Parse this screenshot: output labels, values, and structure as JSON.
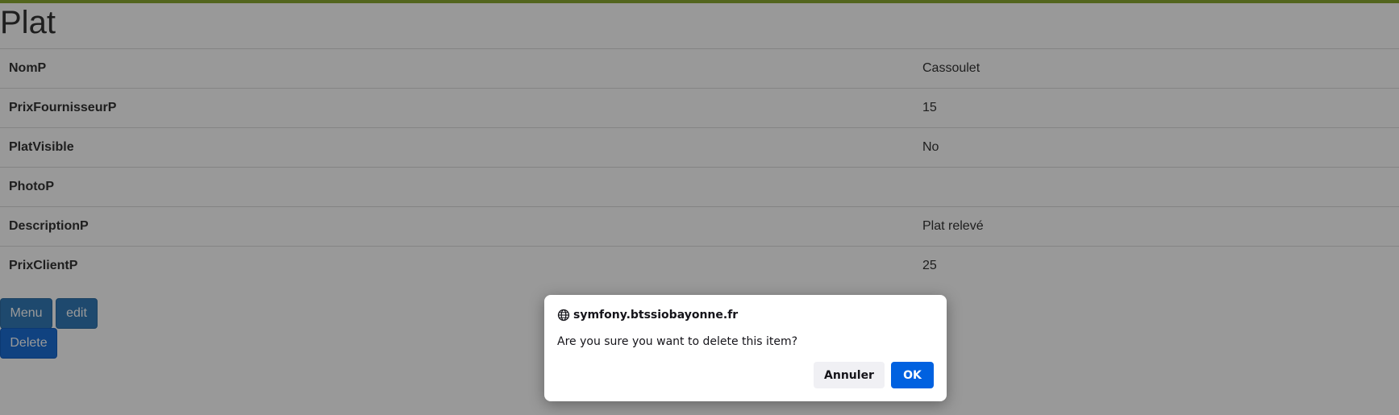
{
  "page": {
    "title": "Plat",
    "rows": [
      {
        "label": "NomP",
        "value": "Cassoulet"
      },
      {
        "label": "PrixFournisseurP",
        "value": "15"
      },
      {
        "label": "PlatVisible",
        "value": "No"
      },
      {
        "label": "PhotoP",
        "value": ""
      },
      {
        "label": "DescriptionP",
        "value": "Plat relevé"
      },
      {
        "label": "PrixClientP",
        "value": "25"
      }
    ],
    "buttons": {
      "menu": "Menu",
      "edit": "edit",
      "delete": "Delete"
    }
  },
  "dialog": {
    "origin": "symfony.btssiobayonne.fr",
    "origin_icon": "globe-icon",
    "message": "Are you sure you want to delete this item?",
    "cancel_label": "Annuler",
    "ok_label": "OK"
  },
  "colors": {
    "accent_bar": "#8aa832",
    "button_primary": "#337ab7",
    "dialog_ok": "#0061e0"
  }
}
